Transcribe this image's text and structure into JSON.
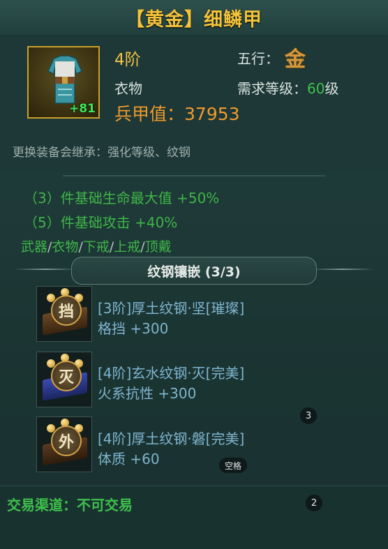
{
  "item": {
    "title": "【黄金】细鳞甲",
    "tier": "4阶",
    "type": "衣物",
    "element_label": "五行：",
    "element_value": "金",
    "level_req_label": "需求等级：",
    "level_req_value": "60",
    "level_req_unit": "级",
    "power_label": "兵甲值：",
    "power_value": "37953",
    "enhance_level": "+81",
    "inherit_note": "更换装备会继承：强化等级、纹钢",
    "icon": "armor-icon"
  },
  "set_bonus": {
    "lines": [
      {
        "text": "（3）件基础生命最大值  +50%"
      },
      {
        "text": "（5）件基础攻击  +40%"
      }
    ],
    "parts": [
      "武器",
      "衣物",
      "下戒",
      "上戒",
      "顶戴"
    ],
    "separator": "/"
  },
  "sockets": {
    "header": "纹钢镶嵌 (3/3)",
    "gems": [
      {
        "glyph": "挡",
        "name": "[3阶]厚土纹钢·坚[璀璨]",
        "stat": "格挡  +300",
        "base_color": "#5a3a1e"
      },
      {
        "glyph": "灭",
        "name": "[4阶]玄水纹钢·灭[完美]",
        "stat": "火系抗性  +300",
        "base_color": "#2c3a86"
      },
      {
        "glyph": "外",
        "name": "[4阶]厚土纹钢·磐[完美]",
        "stat": "体质  +60",
        "base_color": "#4a2e18"
      }
    ]
  },
  "hints": {
    "badge_3": "3",
    "badge_2": "2",
    "space_key": "空格"
  },
  "footer": {
    "trade_label": "交易渠道：不可交易"
  },
  "colors": {
    "gold": "#f1c247",
    "green": "#3fb548",
    "gem_text": "#7fb5cf",
    "background": "#1c3735"
  }
}
